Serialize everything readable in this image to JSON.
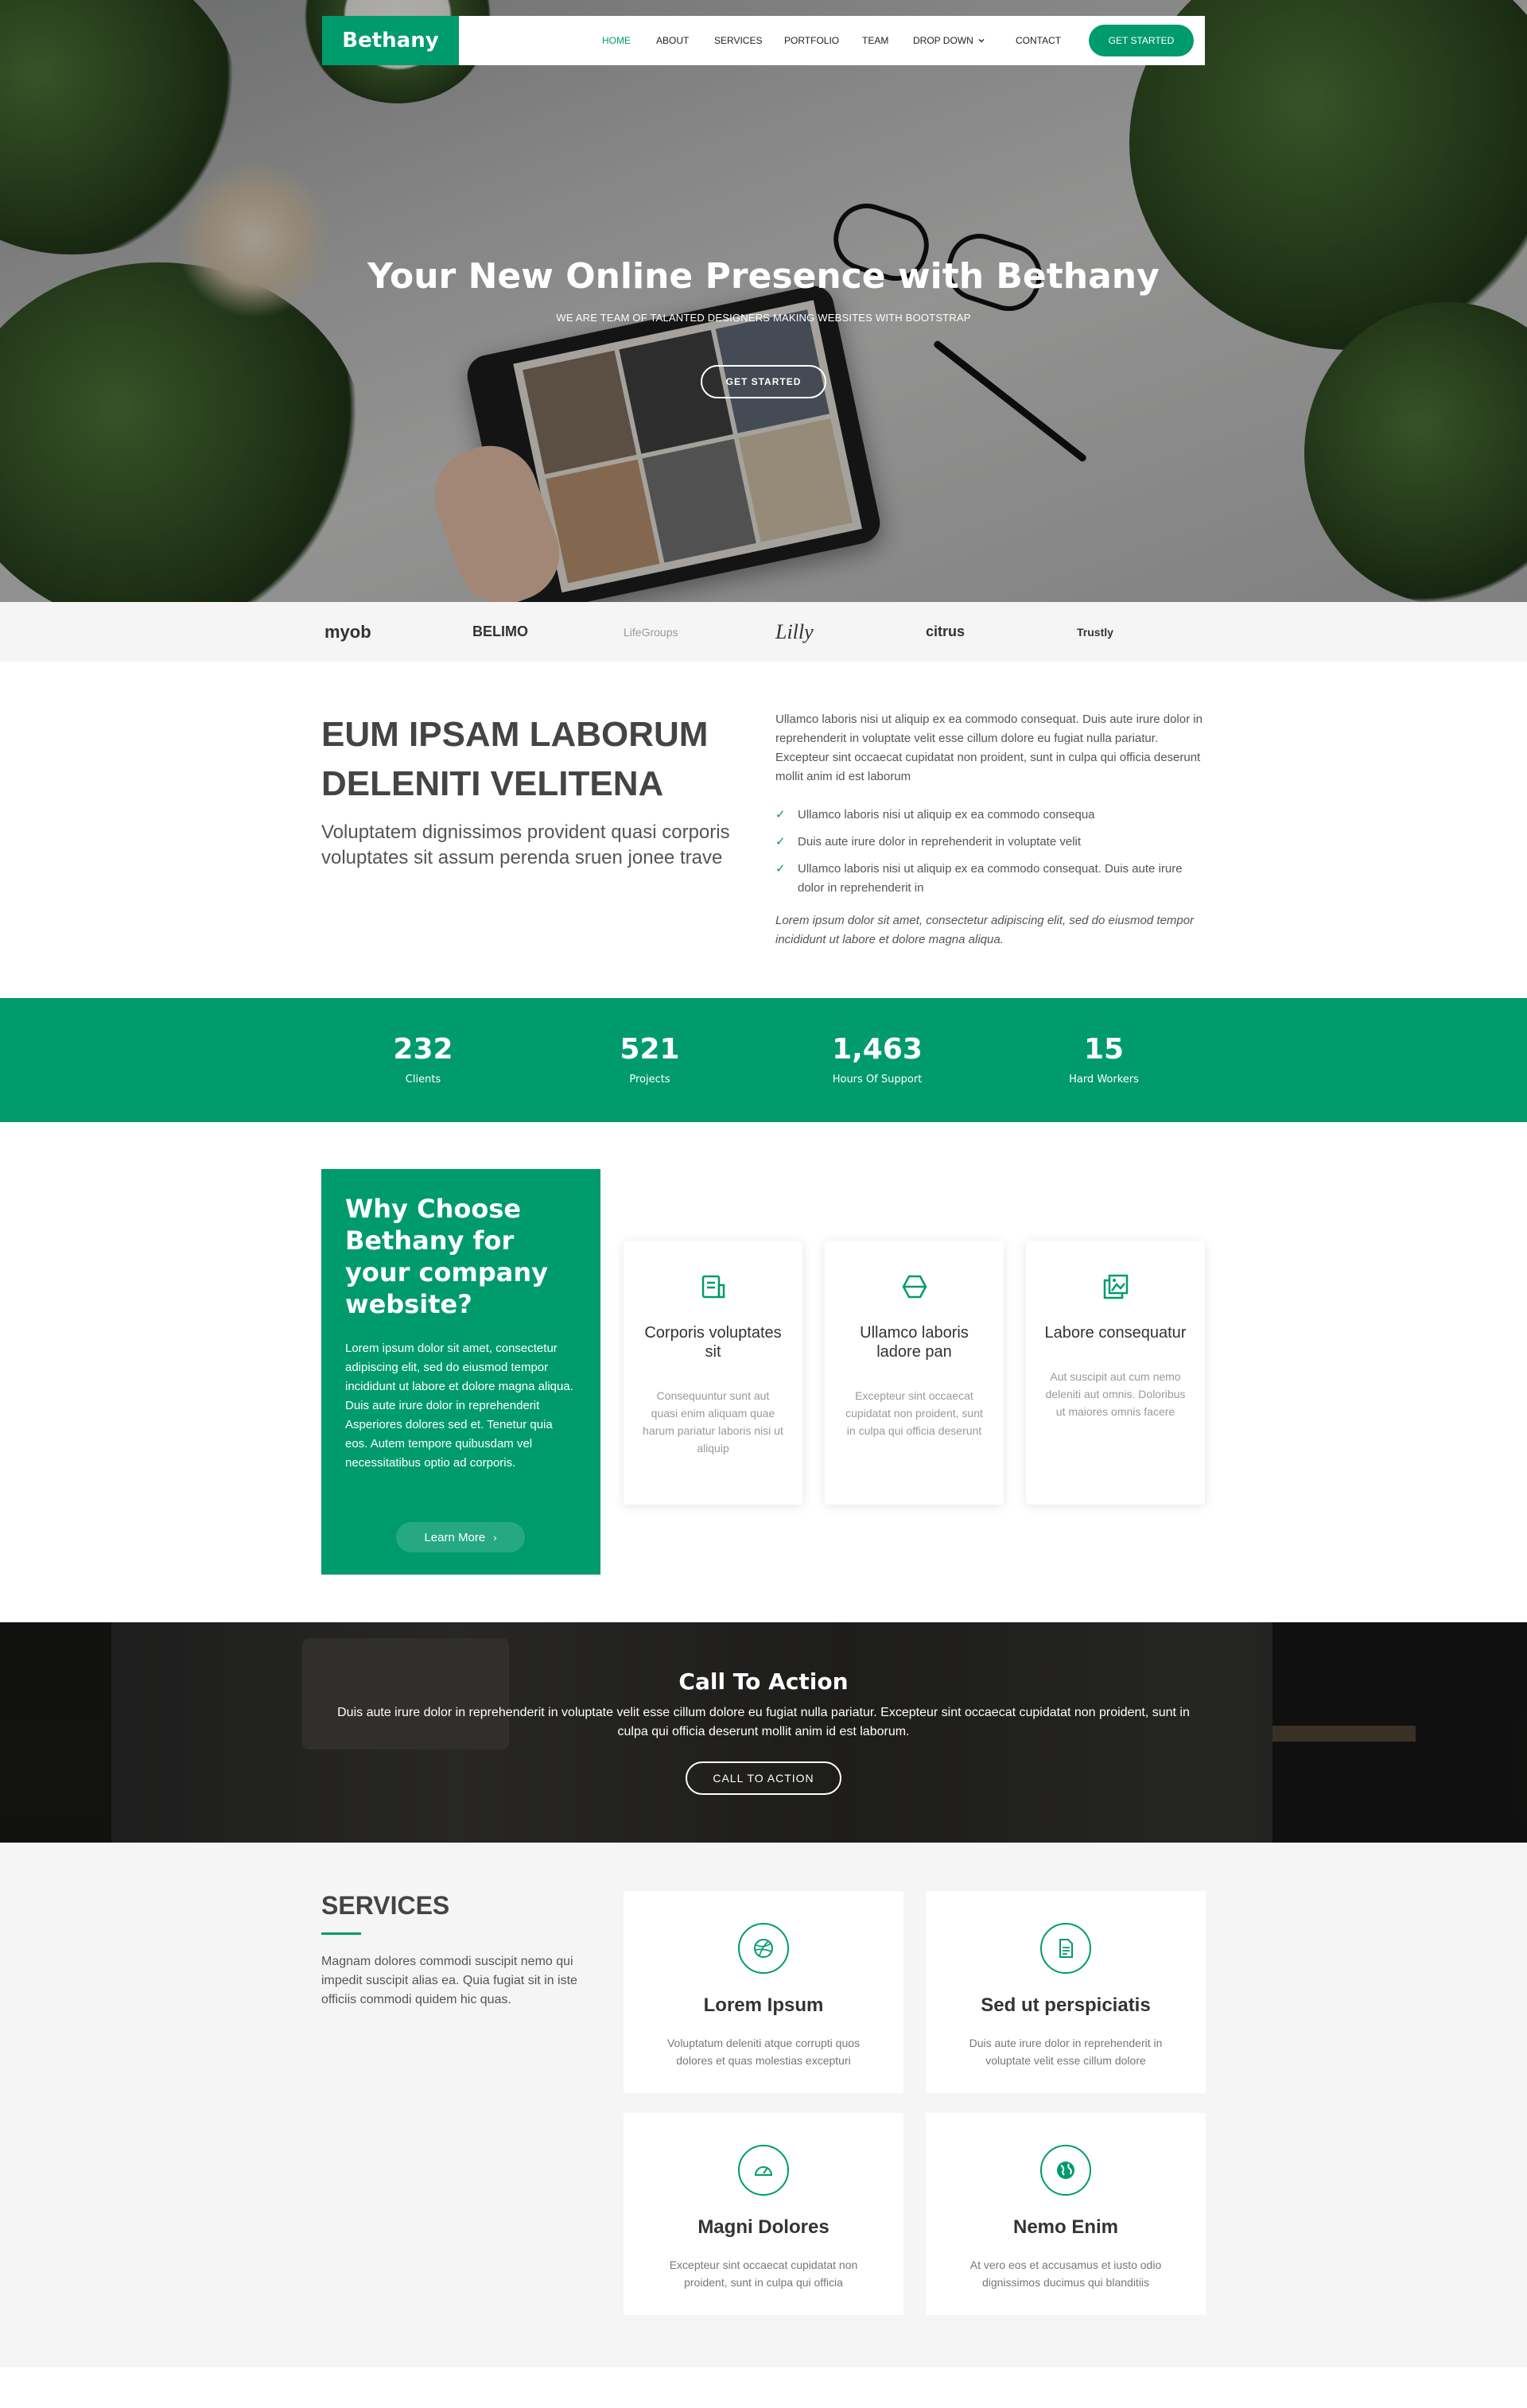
{
  "colors": {
    "accent": "#009b6d",
    "dark_text": "#444444",
    "muted_text": "#999999",
    "section_bg": "#f5f5f6"
  },
  "nav": {
    "logo": "Bethany",
    "links": [
      "HOME",
      "ABOUT",
      "SERVICES",
      "PORTFOLIO",
      "TEAM",
      "DROP DOWN",
      "CONTACT"
    ],
    "dropdown_icon": "chevron-down-icon",
    "cta": "GET STARTED"
  },
  "hero": {
    "title": "Your New Online Presence with Bethany",
    "subtitle": "WE ARE TEAM OF TALANTED DESIGNERS MAKING WEBSITES WITH BOOTSTRAP",
    "button": "GET STARTED"
  },
  "clients": [
    "myob",
    "BELIMO",
    "LifeGroups",
    "Lilly",
    "citrus",
    "Trustly"
  ],
  "about": {
    "heading": "EUM IPSAM LABORUM DELENITI VELITENA",
    "lead": "Voluptatem dignissimos provident quasi corporis voluptates sit assum perenda sruen jonee trave",
    "paragraph": "Ullamco laboris nisi ut aliquip ex ea commodo consequat. Duis aute irure dolor in reprehenderit in voluptate velit esse cillum dolore eu fugiat nulla pariatur. Excepteur sint occaecat cupidatat non proident, sunt in culpa qui officia deserunt mollit anim id est laborum",
    "list": [
      "Ullamco laboris nisi ut aliquip ex ea commodo consequa",
      "Duis aute irure dolor in reprehenderit in voluptate velit",
      "Ullamco laboris nisi ut aliquip ex ea commodo consequat. Duis aute irure dolor in reprehenderit in"
    ],
    "list_icon": "check-double-icon",
    "italic": "Lorem ipsum dolor sit amet, consectetur adipiscing elit, sed do eiusmod tempor incididunt ut labore et dolore magna aliqua."
  },
  "counts": [
    {
      "value": "232",
      "label": "Clients"
    },
    {
      "value": "521",
      "label": "Projects"
    },
    {
      "value": "1,463",
      "label": "Hours Of Support"
    },
    {
      "value": "15",
      "label": "Hard Workers"
    }
  ],
  "why": {
    "heading": "Why Choose Bethany for your company website?",
    "text": "Lorem ipsum dolor sit amet, consectetur adipiscing elit, sed do eiusmod tempor incididunt ut labore et dolore magna aliqua. Duis aute irure dolor in reprehenderit Asperiores dolores sed et. Tenetur quia eos. Autem tempore quibusdam vel necessitatibus optio ad corporis.",
    "button": "Learn More",
    "button_icon": "chevron-right-icon",
    "boxes": [
      {
        "icon": "receipt-icon",
        "title": "Corporis voluptates sit",
        "text": "Consequuntur sunt aut quasi enim aliquam quae harum pariatur laboris nisi ut aliquip"
      },
      {
        "icon": "cube-alt-icon",
        "title": "Ullamco laboris ladore pan",
        "text": "Excepteur sint occaecat cupidatat non proident, sunt in culpa qui officia deserunt"
      },
      {
        "icon": "images-icon",
        "title": "Labore consequatur",
        "text": "Aut suscipit aut cum nemo deleniti aut omnis. Doloribus ut maiores omnis facere"
      }
    ]
  },
  "cta": {
    "title": "Call To Action",
    "text": "Duis aute irure dolor in reprehenderit in voluptate velit esse cillum dolore eu fugiat nulla pariatur. Excepteur sint occaecat cupidatat non proident, sunt in culpa qui officia deserunt mollit anim id est laborum.",
    "button": "CALL TO ACTION"
  },
  "services": {
    "heading": "SERVICES",
    "text": "Magnam dolores commodi suscipit nemo qui impedit suscipit alias ea. Quia fugiat sit in iste officiis commodi quidem hic quas.",
    "items": [
      {
        "icon": "dribbble-icon",
        "title": "Lorem Ipsum",
        "text": "Voluptatum deleniti atque corrupti quos dolores et quas molestias excepturi"
      },
      {
        "icon": "file-icon",
        "title": "Sed ut perspiciatis",
        "text": "Duis aute irure dolor in reprehenderit in voluptate velit esse cillum dolore"
      },
      {
        "icon": "tachometer-icon",
        "title": "Magni Dolores",
        "text": "Excepteur sint occaecat cupidatat non proident, sunt in culpa qui officia"
      },
      {
        "icon": "world-icon",
        "title": "Nemo Enim",
        "text": "At vero eos et accusamus et iusto odio dignissimos ducimus qui blanditiis"
      }
    ]
  }
}
